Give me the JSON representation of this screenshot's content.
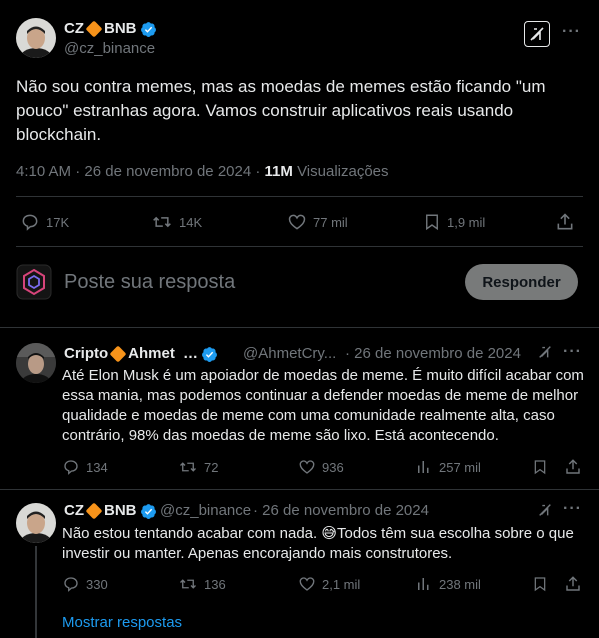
{
  "main_tweet": {
    "author_name": "CZ",
    "author_tag": "BNB",
    "handle": "@cz_binance",
    "text": "Não sou contra memes, mas as moedas de memes estão ficando \"um pouco\" estranhas agora. Vamos construir aplicativos reais usando blockchain.",
    "time": "4:10 AM",
    "sep1": "·",
    "date": "26 de novembro de 2024",
    "sep2": "·",
    "views_count": "11M",
    "views_label": "Visualizações",
    "stats": {
      "replies": "17K",
      "reposts": "14K",
      "likes": "77 mil",
      "bookmarks": "1,9 mil"
    }
  },
  "composer": {
    "placeholder": "Poste sua resposta",
    "button_label": "Responder"
  },
  "replies": [
    {
      "author_name": "Cripto",
      "author_name2": "Ahmet",
      "ellipsis": "…",
      "handle": "@AhmetCry...",
      "date": "· 26 de novembro de 2024",
      "text": "Até Elon Musk é um apoiador de moedas de meme. É muito difícil acabar com essa mania, mas podemos continuar a defender moedas de meme de melhor qualidade e moedas de meme com uma comunidade realmente alta, caso contrário, 98% das moedas de meme são lixo. Está acontecendo.",
      "stats": {
        "replies": "134",
        "reposts": "72",
        "likes": "936",
        "views": "257 mil"
      }
    },
    {
      "author_name": "CZ",
      "author_tag": "BNB",
      "handle": "@cz_binance",
      "date": "· 26 de novembro de 2024",
      "text": "Não estou tentando acabar com nada. 😅Todos têm sua escolha sobre o que investir ou manter. Apenas encorajando mais construtores.",
      "stats": {
        "replies": "330",
        "reposts": "136",
        "likes": "2,1 mil",
        "views": "238 mil"
      }
    }
  ],
  "show_replies": "Mostrar respostas",
  "colors": {
    "accent": "#1d9bf0",
    "muted": "#71767b",
    "bnb": "#f7931a",
    "background": "#000000"
  },
  "icons": [
    "grok-icon",
    "more-icon",
    "reply-icon",
    "repost-icon",
    "like-icon",
    "bookmark-icon",
    "share-icon",
    "views-icon",
    "verified-badge-icon"
  ]
}
